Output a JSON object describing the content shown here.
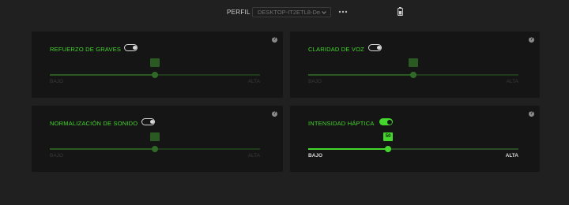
{
  "header": {
    "profile_label": "PERFIL",
    "profile_value": "DESKTOP-IT2ETL8-De...",
    "more_icon": "more-horizontal-icon",
    "battery_icon": "battery-icon"
  },
  "colors": {
    "accent": "#44d62c",
    "card_bg": "#151515",
    "page_bg": "#202020"
  },
  "cards": [
    {
      "title": "REFUERZO DE GRAVES",
      "enabled": false,
      "slider": {
        "value": "",
        "fraction": 0.5,
        "low_label": "BAJO",
        "high_label": "ALTA"
      }
    },
    {
      "title": "CLARIDAD DE VOZ",
      "enabled": false,
      "slider": {
        "value": "",
        "fraction": 0.5,
        "low_label": "BAJO",
        "high_label": "ALTA"
      }
    },
    {
      "title": "NORMALIZACIÓN DE SONIDO",
      "enabled": false,
      "slider": {
        "value": "",
        "fraction": 0.5,
        "low_label": "BAJO",
        "high_label": "ALTA"
      }
    },
    {
      "title": "INTENSIDAD HÁPTICA",
      "enabled": true,
      "slider": {
        "value": "50",
        "fraction": 0.38,
        "low_label": "BAJO",
        "high_label": "ALTA"
      }
    }
  ]
}
